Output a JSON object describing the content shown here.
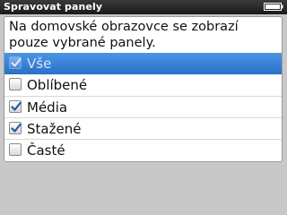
{
  "title_bar": {
    "title": "Spravovat panely",
    "battery_icon": "battery-icon"
  },
  "panel": {
    "description": "Na domovské obrazovce se zobrazí pouze vybrané panely.",
    "options": [
      {
        "label": "Vše",
        "checked": true,
        "selected": true
      },
      {
        "label": "Oblíbené",
        "checked": false,
        "selected": false
      },
      {
        "label": "Média",
        "checked": true,
        "selected": false
      },
      {
        "label": "Stažené",
        "checked": true,
        "selected": false
      },
      {
        "label": "Časté",
        "checked": false,
        "selected": false
      }
    ]
  },
  "colors": {
    "highlight": "#2a70c8",
    "background": "#c8c8c8",
    "checkmark": "#1f5aa8"
  }
}
